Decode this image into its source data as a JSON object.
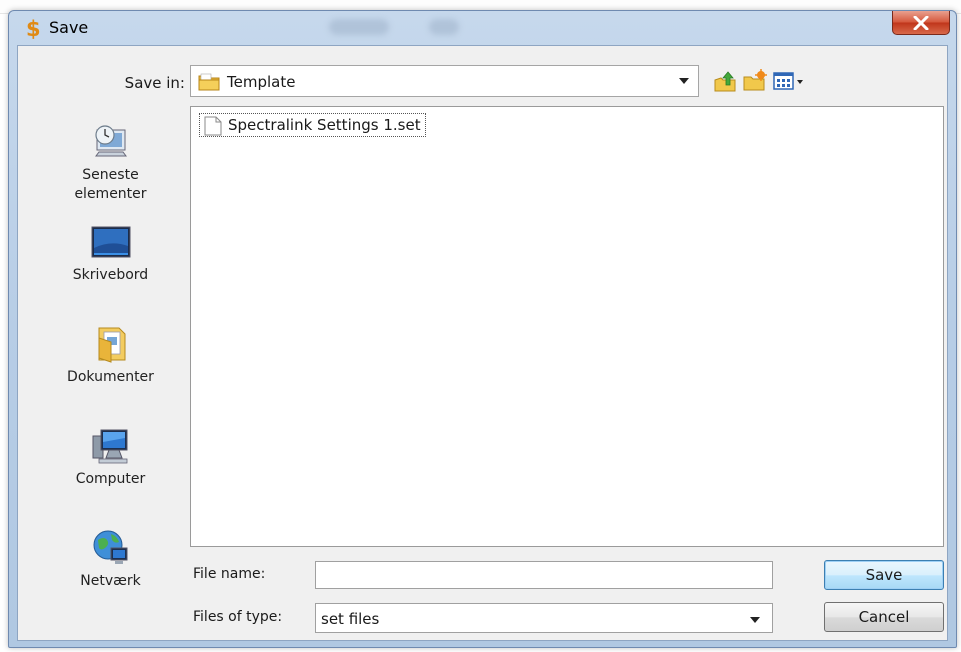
{
  "window": {
    "title": "Save",
    "icon": "dollar-app-icon",
    "close_icon": "close-icon"
  },
  "toolbar": {
    "save_in_label": "Save in:",
    "save_in_value": "Template",
    "buttons": [
      "up-one-level-icon",
      "create-new-folder-icon",
      "view-menu-icon"
    ]
  },
  "places": [
    {
      "label": "Seneste\nelementer",
      "icon": "recent-places-icon"
    },
    {
      "label": "Skrivebord",
      "icon": "desktop-icon"
    },
    {
      "label": "Dokumenter",
      "icon": "documents-folder-icon"
    },
    {
      "label": "Computer",
      "icon": "computer-icon"
    },
    {
      "label": "Netværk",
      "icon": "network-icon"
    }
  ],
  "files": [
    {
      "name": "Spectralink Settings 1.set",
      "icon": "document-icon"
    }
  ],
  "form": {
    "file_name_label": "File name:",
    "file_name_value": "",
    "files_of_type_label": "Files of type:",
    "files_of_type_value": "set files"
  },
  "buttons": {
    "save": "Save",
    "cancel": "Cancel"
  }
}
